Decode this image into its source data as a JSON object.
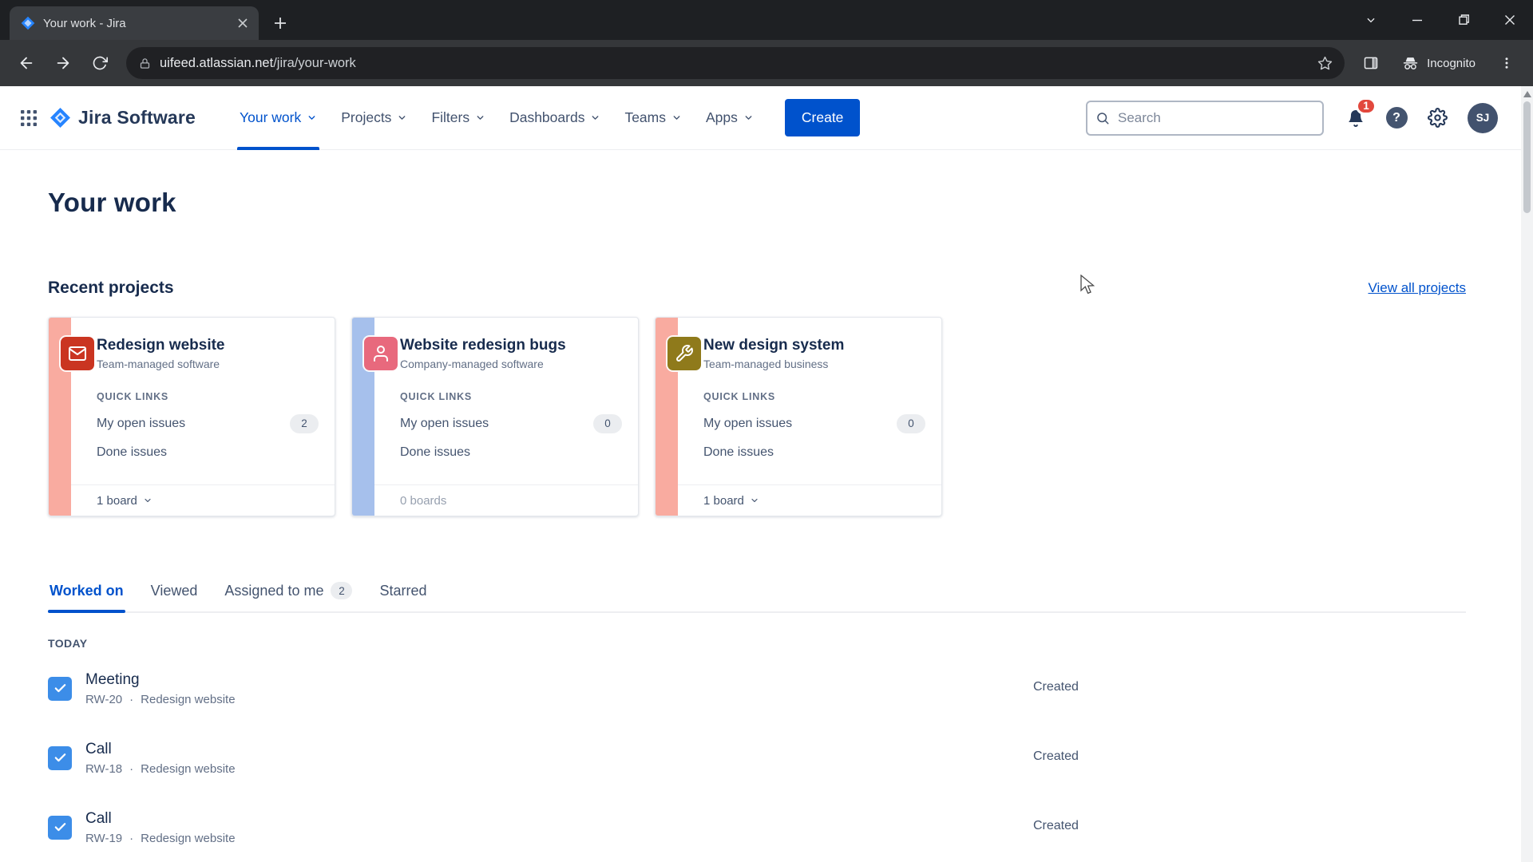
{
  "browser": {
    "tab_title": "Your work - Jira",
    "url_host": "uifeed.atlassian.net",
    "url_path": "/jira/your-work",
    "incognito_label": "Incognito"
  },
  "header": {
    "product_name": "Jira Software",
    "nav": [
      {
        "label": "Your work",
        "active": true
      },
      {
        "label": "Projects"
      },
      {
        "label": "Filters"
      },
      {
        "label": "Dashboards"
      },
      {
        "label": "Teams"
      },
      {
        "label": "Apps"
      }
    ],
    "create_label": "Create",
    "search_placeholder": "Search",
    "notification_count": "1",
    "help_glyph": "?",
    "avatar_initials": "SJ"
  },
  "page": {
    "title": "Your work",
    "recent": {
      "heading": "Recent projects",
      "view_all_label": "View all projects",
      "quick_links_label": "QUICK LINKS",
      "cards": [
        {
          "title": "Redesign website",
          "subtitle": "Team-managed software",
          "open_label": "My open issues",
          "open_count": "2",
          "done_label": "Done issues",
          "footer_label": "1 board",
          "expandable": true
        },
        {
          "title": "Website redesign bugs",
          "subtitle": "Company-managed software",
          "open_label": "My open issues",
          "open_count": "0",
          "done_label": "Done issues",
          "footer_label": "0 boards",
          "expandable": false
        },
        {
          "title": "New design system",
          "subtitle": "Team-managed business",
          "open_label": "My open issues",
          "open_count": "0",
          "done_label": "Done issues",
          "footer_label": "1 board",
          "expandable": true
        }
      ]
    },
    "tabs": [
      {
        "label": "Worked on",
        "active": true
      },
      {
        "label": "Viewed"
      },
      {
        "label": "Assigned to me",
        "badge": "2"
      },
      {
        "label": "Starred"
      }
    ],
    "today_label": "TODAY",
    "separator": "·",
    "items": [
      {
        "title": "Meeting",
        "key": "RW-20",
        "project": "Redesign website",
        "status": "Created"
      },
      {
        "title": "Call",
        "key": "RW-18",
        "project": "Redesign website",
        "status": "Created"
      },
      {
        "title": "Call",
        "key": "RW-19",
        "project": "Redesign website",
        "status": "Created"
      }
    ]
  },
  "colors": {
    "accent_blue": "#0052CC",
    "heading_text": "#172B4D",
    "muted_text": "#626F86",
    "notification_badge": "#E2483D",
    "task_icon_blue": "#3C8DE8",
    "card1_stripe": "#F9ABA0",
    "card2_stripe": "#A6C0EC",
    "card3_stripe": "#F9ABA0",
    "card1_icon_bg": "#CA3521",
    "card2_icon_bg": "#E8697D",
    "card3_icon_bg": "#8F7A1B"
  }
}
